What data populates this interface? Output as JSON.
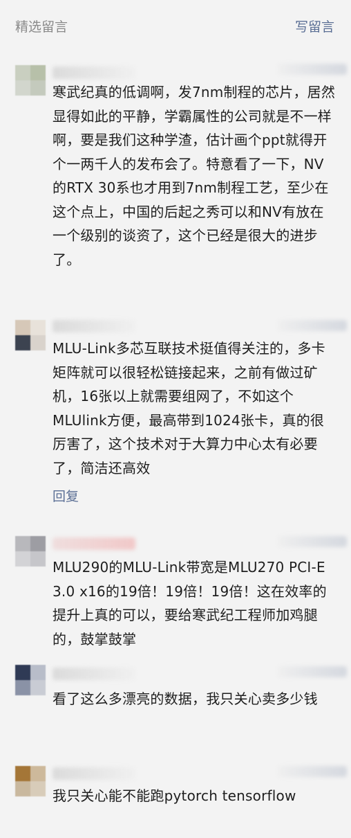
{
  "header": {
    "title": "精选留言",
    "write_label": "写留言"
  },
  "comments": [
    {
      "text": "寒武纪真的低调啊，发7nm制程的芯片，居然显得如此的平静，学霸属性的公司就是不一样啊，要是我们这种学渣，估计画个ppt就得开个一两千人的发布会了。特意看了一下，NV的RTX 30系也才用到7nm制程工艺，至少在这个点上，中国的后起之秀可以和NV有放在一个级别的谈资了，这个已经是很大的进步了。"
    },
    {
      "text": "MLU-Link多芯互联技术挺值得关注的，多卡矩阵就可以很轻松链接起来，之前有做过矿机，16张以上就需要组网了，不如这个MLUlink方便，最高带到1024张卡，真的很厉害了，这个技术对于大算力中心太有必要了，简洁还高效",
      "reply_label": "回复"
    },
    {
      "text": "MLU290的MLU-Link带宽是MLU270 PCI-E 3.0 x16的19倍！19倍！19倍！这在效率的提升上真的可以，要给寒武纪工程师加鸡腿的，鼓掌鼓掌"
    },
    {
      "text": "看了这么多漂亮的数据，我只关心卖多少钱"
    },
    {
      "text": "我只关心能不能跑pytorch tensorflow"
    }
  ]
}
